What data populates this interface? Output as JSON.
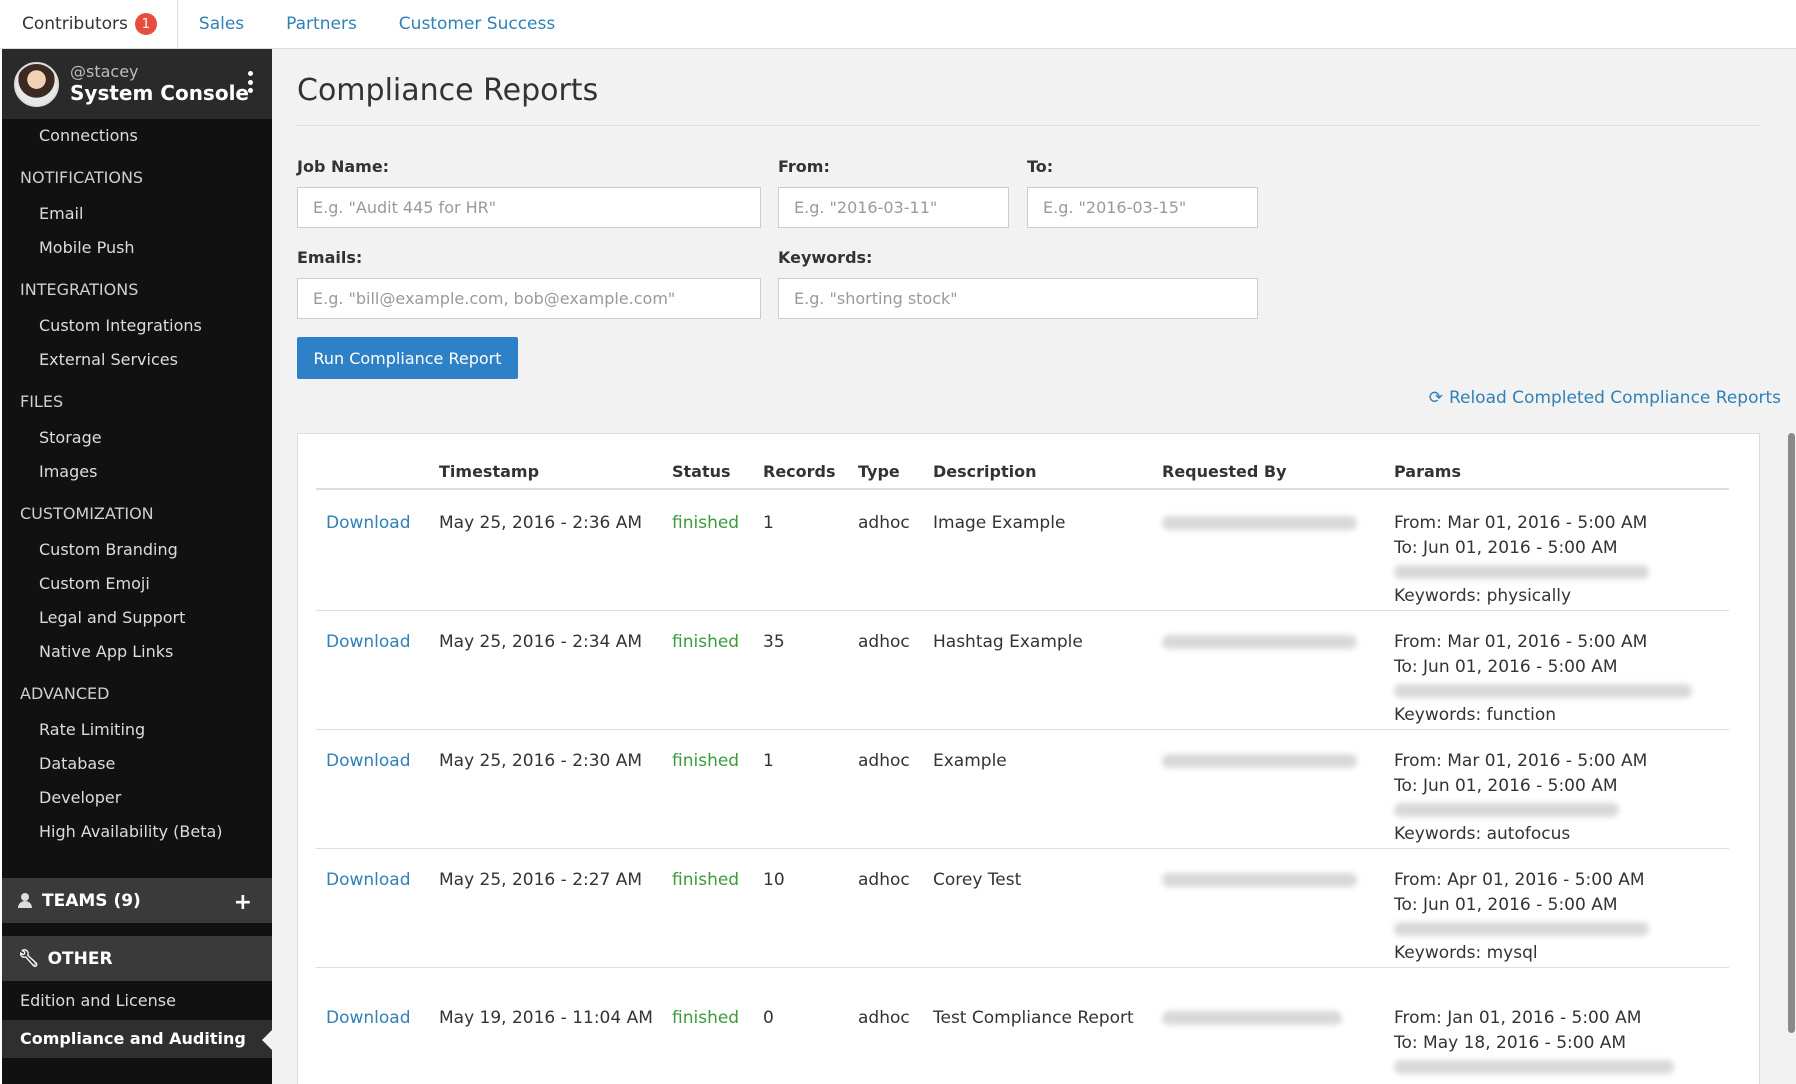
{
  "tabs": [
    {
      "label": "Contributors",
      "badge": "1"
    },
    {
      "label": "Sales"
    },
    {
      "label": "Partners"
    },
    {
      "label": "Customer Success"
    }
  ],
  "sidebar": {
    "user": "@stacey",
    "title": "System Console",
    "first_item": "Connections",
    "sections": [
      {
        "title": "NOTIFICATIONS",
        "items": [
          "Email",
          "Mobile Push"
        ]
      },
      {
        "title": "INTEGRATIONS",
        "items": [
          "Custom Integrations",
          "External Services"
        ]
      },
      {
        "title": "FILES",
        "items": [
          "Storage",
          "Images"
        ]
      },
      {
        "title": "CUSTOMIZATION",
        "items": [
          "Custom Branding",
          "Custom Emoji",
          "Legal and Support",
          "Native App Links"
        ]
      },
      {
        "title": "ADVANCED",
        "items": [
          "Rate Limiting",
          "Database",
          "Developer",
          "High Availability (Beta)"
        ]
      }
    ],
    "teams_label": "TEAMS (9)",
    "other_label": "OTHER",
    "other_items": [
      "Edition and License",
      "Compliance and Auditing"
    ]
  },
  "main": {
    "title": "Compliance Reports",
    "form": {
      "job_name_label": "Job Name:",
      "job_name_placeholder": "E.g. \"Audit 445 for HR\"",
      "from_label": "From:",
      "from_placeholder": "E.g. \"2016-03-11\"",
      "to_label": "To:",
      "to_placeholder": "E.g. \"2016-03-15\"",
      "emails_label": "Emails:",
      "emails_placeholder": "E.g. \"bill@example.com, bob@example.com\"",
      "keywords_label": "Keywords:",
      "keywords_placeholder": "E.g. \"shorting stock\"",
      "run_label": "Run Compliance Report"
    },
    "reload_label": "Reload Completed Compliance Reports",
    "table": {
      "headers": [
        "Timestamp",
        "Status",
        "Records",
        "Type",
        "Description",
        "Requested By",
        "Params"
      ],
      "rows": [
        {
          "download": "Download",
          "timestamp": "May 25, 2016 - 2:36 AM",
          "status": "finished",
          "records": "1",
          "type": "adhoc",
          "description": "Image Example",
          "from": "From: Mar 01, 2016 - 5:00 AM",
          "to": "To: Jun 01, 2016 - 5:00 AM",
          "keywords": "Keywords: physically"
        },
        {
          "download": "Download",
          "timestamp": "May 25, 2016 - 2:34 AM",
          "status": "finished",
          "records": "35",
          "type": "adhoc",
          "description": "Hashtag Example",
          "from": "From: Mar 01, 2016 - 5:00 AM",
          "to": "To: Jun 01, 2016 - 5:00 AM",
          "keywords": "Keywords: function"
        },
        {
          "download": "Download",
          "timestamp": "May 25, 2016 - 2:30 AM",
          "status": "finished",
          "records": "1",
          "type": "adhoc",
          "description": "Example",
          "from": "From: Mar 01, 2016 - 5:00 AM",
          "to": "To: Jun 01, 2016 - 5:00 AM",
          "keywords": "Keywords: autofocus"
        },
        {
          "download": "Download",
          "timestamp": "May 25, 2016 - 2:27 AM",
          "status": "finished",
          "records": "10",
          "type": "adhoc",
          "description": "Corey Test",
          "from": "From: Apr 01, 2016 - 5:00 AM",
          "to": "To: Jun 01, 2016 - 5:00 AM",
          "keywords": "Keywords: mysql"
        },
        {
          "download": "Download",
          "timestamp": "May 19, 2016 - 11:04 AM",
          "status": "finished",
          "records": "0",
          "type": "adhoc",
          "description": "Test Compliance Report",
          "from": "From: Jan 01, 2016 - 5:00 AM",
          "to": "To: May 18, 2016 - 5:00 AM",
          "keywords": ""
        }
      ]
    }
  },
  "colors": {
    "accent": "#2f81c7",
    "link": "#2f81b7",
    "status_finished": "#3c9a3c",
    "badge": "#e74c3c",
    "sidebar_bg": "#111111"
  }
}
